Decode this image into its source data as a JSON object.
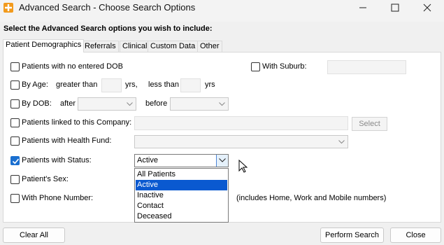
{
  "window": {
    "title": "Advanced Search - Choose Search Options"
  },
  "intro": "Select the Advanced Search options you wish to include:",
  "tabs": [
    "Patient Demographics",
    "Referrals",
    "Clinical",
    "Custom Data",
    "Other"
  ],
  "active_tab": "Patient Demographics",
  "options": {
    "no_dob": "Patients with no entered DOB",
    "with_suburb": "With Suburb:",
    "by_age": "By Age:",
    "age_greater": "greater than",
    "age_yrs1": "yrs,",
    "age_less": "less than",
    "age_yrs2": "yrs",
    "by_dob": "By DOB:",
    "dob_after": "after",
    "dob_before": "before",
    "linked_company": "Patients linked to this Company:",
    "select_button": "Select",
    "health_fund": "Patients with Health Fund:",
    "with_status": "Patients with Status:",
    "status_value": "Active",
    "sex": "Patient's Sex:",
    "phone": "With Phone Number:",
    "phone_note": "(includes Home, Work and Mobile numbers)"
  },
  "status_checked": true,
  "status_options": [
    "All Patients",
    "Active",
    "Inactive",
    "Contact",
    "Deceased"
  ],
  "status_selected": "Active",
  "buttons": {
    "clear_all": "Clear All",
    "perform_search": "Perform Search",
    "close": "Close"
  },
  "colors": {
    "accent": "#1a6fd0",
    "selection": "#0a59d0",
    "app_icon": "#f29a1c"
  }
}
